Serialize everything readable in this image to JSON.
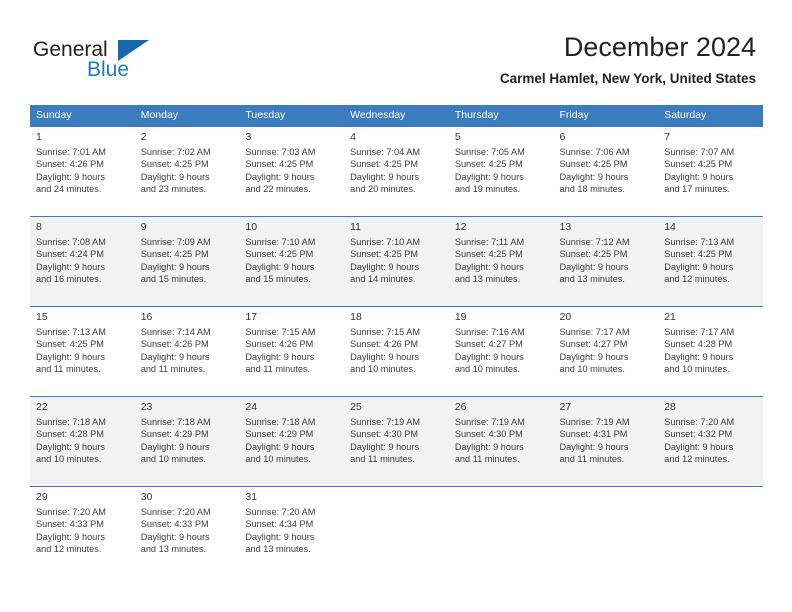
{
  "brand": {
    "word_one": "General",
    "word_two": "Blue",
    "triangle_icon": "brand-triangle-icon",
    "colors": {
      "blue": "#1f7ac4",
      "triangle": "#1667ae",
      "dark": "#231f20"
    }
  },
  "header": {
    "title": "December 2024",
    "subtitle": "Carmel Hamlet, New York, United States"
  },
  "theme": {
    "header_row_bg": "#3b7cbe",
    "header_row_text": "#ffffff",
    "row_shade_bg": "#f2f2f2",
    "grid_line": "#3b7cbe"
  },
  "weekdays": [
    "Sunday",
    "Monday",
    "Tuesday",
    "Wednesday",
    "Thursday",
    "Friday",
    "Saturday"
  ],
  "weeks": [
    {
      "shaded": false,
      "days": [
        {
          "num": "1",
          "info": "Sunrise: 7:01 AM\nSunset: 4:26 PM\nDaylight: 9 hours\nand 24 minutes."
        },
        {
          "num": "2",
          "info": "Sunrise: 7:02 AM\nSunset: 4:25 PM\nDaylight: 9 hours\nand 23 minutes."
        },
        {
          "num": "3",
          "info": "Sunrise: 7:03 AM\nSunset: 4:25 PM\nDaylight: 9 hours\nand 22 minutes."
        },
        {
          "num": "4",
          "info": "Sunrise: 7:04 AM\nSunset: 4:25 PM\nDaylight: 9 hours\nand 20 minutes."
        },
        {
          "num": "5",
          "info": "Sunrise: 7:05 AM\nSunset: 4:25 PM\nDaylight: 9 hours\nand 19 minutes."
        },
        {
          "num": "6",
          "info": "Sunrise: 7:06 AM\nSunset: 4:25 PM\nDaylight: 9 hours\nand 18 minutes."
        },
        {
          "num": "7",
          "info": "Sunrise: 7:07 AM\nSunset: 4:25 PM\nDaylight: 9 hours\nand 17 minutes."
        }
      ]
    },
    {
      "shaded": true,
      "days": [
        {
          "num": "8",
          "info": "Sunrise: 7:08 AM\nSunset: 4:24 PM\nDaylight: 9 hours\nand 16 minutes."
        },
        {
          "num": "9",
          "info": "Sunrise: 7:09 AM\nSunset: 4:25 PM\nDaylight: 9 hours\nand 15 minutes."
        },
        {
          "num": "10",
          "info": "Sunrise: 7:10 AM\nSunset: 4:25 PM\nDaylight: 9 hours\nand 15 minutes."
        },
        {
          "num": "11",
          "info": "Sunrise: 7:10 AM\nSunset: 4:25 PM\nDaylight: 9 hours\nand 14 minutes."
        },
        {
          "num": "12",
          "info": "Sunrise: 7:11 AM\nSunset: 4:25 PM\nDaylight: 9 hours\nand 13 minutes."
        },
        {
          "num": "13",
          "info": "Sunrise: 7:12 AM\nSunset: 4:25 PM\nDaylight: 9 hours\nand 13 minutes."
        },
        {
          "num": "14",
          "info": "Sunrise: 7:13 AM\nSunset: 4:25 PM\nDaylight: 9 hours\nand 12 minutes."
        }
      ]
    },
    {
      "shaded": false,
      "days": [
        {
          "num": "15",
          "info": "Sunrise: 7:13 AM\nSunset: 4:25 PM\nDaylight: 9 hours\nand 11 minutes."
        },
        {
          "num": "16",
          "info": "Sunrise: 7:14 AM\nSunset: 4:26 PM\nDaylight: 9 hours\nand 11 minutes."
        },
        {
          "num": "17",
          "info": "Sunrise: 7:15 AM\nSunset: 4:26 PM\nDaylight: 9 hours\nand 11 minutes."
        },
        {
          "num": "18",
          "info": "Sunrise: 7:15 AM\nSunset: 4:26 PM\nDaylight: 9 hours\nand 10 minutes."
        },
        {
          "num": "19",
          "info": "Sunrise: 7:16 AM\nSunset: 4:27 PM\nDaylight: 9 hours\nand 10 minutes."
        },
        {
          "num": "20",
          "info": "Sunrise: 7:17 AM\nSunset: 4:27 PM\nDaylight: 9 hours\nand 10 minutes."
        },
        {
          "num": "21",
          "info": "Sunrise: 7:17 AM\nSunset: 4:28 PM\nDaylight: 9 hours\nand 10 minutes."
        }
      ]
    },
    {
      "shaded": true,
      "days": [
        {
          "num": "22",
          "info": "Sunrise: 7:18 AM\nSunset: 4:28 PM\nDaylight: 9 hours\nand 10 minutes."
        },
        {
          "num": "23",
          "info": "Sunrise: 7:18 AM\nSunset: 4:29 PM\nDaylight: 9 hours\nand 10 minutes."
        },
        {
          "num": "24",
          "info": "Sunrise: 7:18 AM\nSunset: 4:29 PM\nDaylight: 9 hours\nand 10 minutes."
        },
        {
          "num": "25",
          "info": "Sunrise: 7:19 AM\nSunset: 4:30 PM\nDaylight: 9 hours\nand 11 minutes."
        },
        {
          "num": "26",
          "info": "Sunrise: 7:19 AM\nSunset: 4:30 PM\nDaylight: 9 hours\nand 11 minutes."
        },
        {
          "num": "27",
          "info": "Sunrise: 7:19 AM\nSunset: 4:31 PM\nDaylight: 9 hours\nand 11 minutes."
        },
        {
          "num": "28",
          "info": "Sunrise: 7:20 AM\nSunset: 4:32 PM\nDaylight: 9 hours\nand 12 minutes."
        }
      ]
    },
    {
      "shaded": false,
      "days": [
        {
          "num": "29",
          "info": "Sunrise: 7:20 AM\nSunset: 4:33 PM\nDaylight: 9 hours\nand 12 minutes."
        },
        {
          "num": "30",
          "info": "Sunrise: 7:20 AM\nSunset: 4:33 PM\nDaylight: 9 hours\nand 13 minutes."
        },
        {
          "num": "31",
          "info": "Sunrise: 7:20 AM\nSunset: 4:34 PM\nDaylight: 9 hours\nand 13 minutes."
        },
        {
          "num": "",
          "info": ""
        },
        {
          "num": "",
          "info": ""
        },
        {
          "num": "",
          "info": ""
        },
        {
          "num": "",
          "info": ""
        }
      ]
    }
  ]
}
